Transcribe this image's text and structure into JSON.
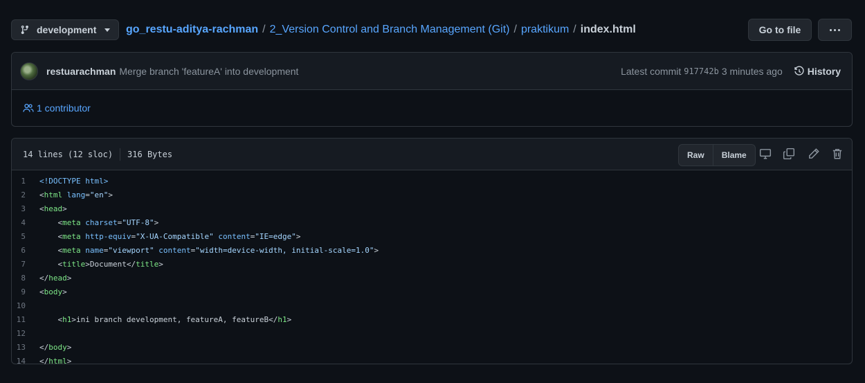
{
  "branch": {
    "name": "development"
  },
  "breadcrumb": {
    "repo": "go_restu-aditya-rachman",
    "folder1": "2_Version Control and Branch Management (Git)",
    "folder2": "praktikum",
    "file": "index.html",
    "separator": "/"
  },
  "actions": {
    "goto_file": "Go to file"
  },
  "commit": {
    "author": "restuarachman",
    "message": "Merge branch 'featureA' into development",
    "latest_label": "Latest commit",
    "sha": "917742b",
    "time": "3 minutes ago",
    "history_label": "History"
  },
  "contributors": {
    "label": "1 contributor"
  },
  "file_info": {
    "lines": "14 lines (12 sloc)",
    "size": "316 Bytes",
    "raw_label": "Raw",
    "blame_label": "Blame"
  },
  "code_lines": [
    {
      "n": "1",
      "tokens": [
        [
          "doc",
          "<!DOCTYPE html>"
        ]
      ]
    },
    {
      "n": "2",
      "tokens": [
        [
          "lc",
          "<"
        ],
        [
          "tag",
          "html"
        ],
        [
          "lc",
          " "
        ],
        [
          "attr",
          "lang"
        ],
        [
          "lc",
          "="
        ],
        [
          "str",
          "\"en\""
        ],
        [
          "lc",
          ">"
        ]
      ]
    },
    {
      "n": "3",
      "tokens": [
        [
          "lc",
          "<"
        ],
        [
          "tag",
          "head"
        ],
        [
          "lc",
          ">"
        ]
      ]
    },
    {
      "n": "4",
      "tokens": [
        [
          "lc",
          "    <"
        ],
        [
          "tag",
          "meta"
        ],
        [
          "lc",
          " "
        ],
        [
          "attr",
          "charset"
        ],
        [
          "lc",
          "="
        ],
        [
          "str",
          "\"UTF-8\""
        ],
        [
          "lc",
          ">"
        ]
      ]
    },
    {
      "n": "5",
      "tokens": [
        [
          "lc",
          "    <"
        ],
        [
          "tag",
          "meta"
        ],
        [
          "lc",
          " "
        ],
        [
          "attr",
          "http-equiv"
        ],
        [
          "lc",
          "="
        ],
        [
          "str",
          "\"X-UA-Compatible\""
        ],
        [
          "lc",
          " "
        ],
        [
          "attr",
          "content"
        ],
        [
          "lc",
          "="
        ],
        [
          "str",
          "\"IE=edge\""
        ],
        [
          "lc",
          ">"
        ]
      ]
    },
    {
      "n": "6",
      "tokens": [
        [
          "lc",
          "    <"
        ],
        [
          "tag",
          "meta"
        ],
        [
          "lc",
          " "
        ],
        [
          "attr",
          "name"
        ],
        [
          "lc",
          "="
        ],
        [
          "str",
          "\"viewport\""
        ],
        [
          "lc",
          " "
        ],
        [
          "attr",
          "content"
        ],
        [
          "lc",
          "="
        ],
        [
          "str",
          "\"width=device-width, initial-scale=1.0\""
        ],
        [
          "lc",
          ">"
        ]
      ]
    },
    {
      "n": "7",
      "tokens": [
        [
          "lc",
          "    <"
        ],
        [
          "tag",
          "title"
        ],
        [
          "lc",
          ">Document</"
        ],
        [
          "tag",
          "title"
        ],
        [
          "lc",
          ">"
        ]
      ]
    },
    {
      "n": "8",
      "tokens": [
        [
          "lc",
          "</"
        ],
        [
          "tag",
          "head"
        ],
        [
          "lc",
          ">"
        ]
      ]
    },
    {
      "n": "9",
      "tokens": [
        [
          "lc",
          "<"
        ],
        [
          "tag",
          "body"
        ],
        [
          "lc",
          ">"
        ]
      ]
    },
    {
      "n": "10",
      "tokens": []
    },
    {
      "n": "11",
      "tokens": [
        [
          "lc",
          "    <"
        ],
        [
          "tag",
          "h1"
        ],
        [
          "lc",
          ">ini branch development, featureA, featureB</"
        ],
        [
          "tag",
          "h1"
        ],
        [
          "lc",
          ">"
        ]
      ]
    },
    {
      "n": "12",
      "tokens": []
    },
    {
      "n": "13",
      "tokens": [
        [
          "lc",
          "</"
        ],
        [
          "tag",
          "body"
        ],
        [
          "lc",
          ">"
        ]
      ]
    },
    {
      "n": "14",
      "tokens": [
        [
          "lc",
          "</"
        ],
        [
          "tag",
          "html"
        ],
        [
          "lc",
          ">"
        ]
      ]
    }
  ],
  "colors": {
    "background": "#0d1117",
    "link": "#58a6ff",
    "tag": "#7ee787",
    "attr": "#79c0ff",
    "string": "#a5d6ff"
  }
}
